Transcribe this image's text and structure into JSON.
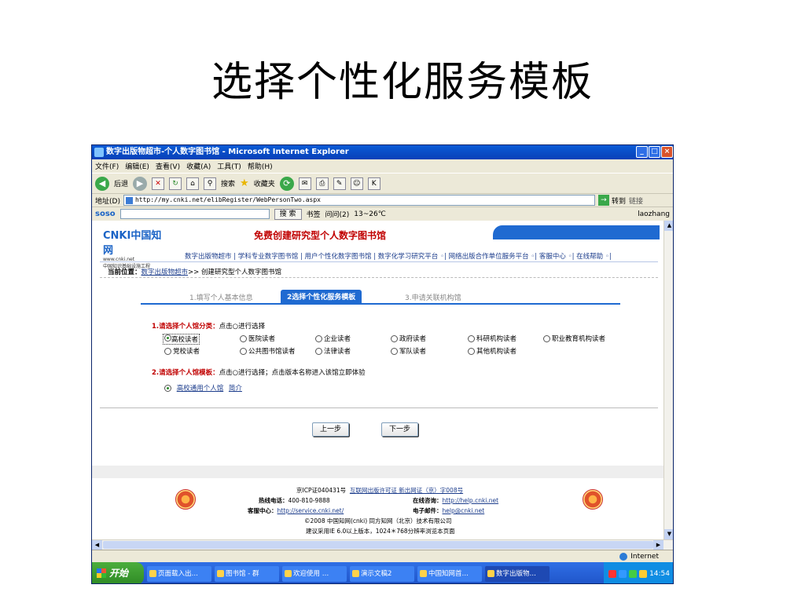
{
  "slide": {
    "title": "选择个性化服务模板"
  },
  "window": {
    "title": "数字出版物超市-个人数字图书馆 - Microsoft Internet Explorer",
    "min": "_",
    "max": "□",
    "close": "×"
  },
  "menu": [
    "文件(F)",
    "编辑(E)",
    "查看(V)",
    "收藏(A)",
    "工具(T)",
    "帮助(H)"
  ],
  "toolbar": {
    "back": "后退",
    "search": "搜索",
    "favorites": "收藏夹"
  },
  "address": {
    "label": "地址(D)",
    "url": "http://my.cnki.net/elibRegister/WebPersonTwo.aspx",
    "go": "转到",
    "links": "链接"
  },
  "soso": {
    "logo": "soso",
    "search_btn": "搜 索",
    "bookmarks": "书签",
    "ask": "问问(2)",
    "weather": "13~26℃",
    "user": "laozhang"
  },
  "page": {
    "logo_main": "CNKI中国知网",
    "logo_url": "www.cnki.net",
    "logo_sub": "中国知识基础设施工程",
    "heading": "免费创建研究型个人数字图书馆",
    "nav": "数字出版物超市 | 学科专业数字图书馆 | 用户个性化数字图书馆 | 数字化学习研究平台 ◦| 网络出版合作单位服务平台 ◦| 客服中心 ◦| 在线帮助 ◦|",
    "crumb_label": "当前位置：",
    "crumb_link": "数字出版物超市",
    "crumb_rest": ">> 创建研究型个人数字图书馆",
    "steps": [
      "1.填写个人基本信息",
      "2选择个性化服务模板",
      "3.申请关联机构馆"
    ],
    "sec1_title": "1.请选择个人馆分类：",
    "sec1_hint": "点击○进行选择",
    "options_row1": [
      "高校读者",
      "医院读者",
      "企业读者",
      "政府读者",
      "科研机构读者",
      "职业教育机构读者"
    ],
    "options_row2": [
      "党校读者",
      "公共图书馆读者",
      "法律读者",
      "军队读者",
      "其他机构读者"
    ],
    "sec2_title": "2.请选择个人馆模板：",
    "sec2_hint": "点击○进行选择；点击版本名称进入该馆立即体验",
    "template_link": "高校通用个人馆",
    "template_intro": "简介",
    "prev": "上一步",
    "next": "下一步"
  },
  "footer": {
    "icp": "京ICP证040431号",
    "license": "互联网出版许可证 新出网证（京）字008号",
    "hotline_label": "热线电话：",
    "hotline": "400-810-9888",
    "online_label": "在线咨询：",
    "online": "http://help.cnki.net",
    "service_label": "客服中心：",
    "service": "http://service.cnki.net/",
    "email_label": "电子邮件：",
    "email": "help@cnki.net",
    "copyright": "©2008 中国知网(cnki)  同方知网（北京）技术有限公司",
    "advice": "建议采用IE 6.0以上版本，1024＊768分辨率浏览本页面"
  },
  "status": {
    "zone": "Internet"
  },
  "taskbar": {
    "start": "开始",
    "tasks": [
      "页面载入出…",
      "图书馆 - 群",
      "欢迎使用 …",
      "演示文稿2",
      "中国知网首…",
      "数字出版物…"
    ],
    "clock": "14:54"
  }
}
